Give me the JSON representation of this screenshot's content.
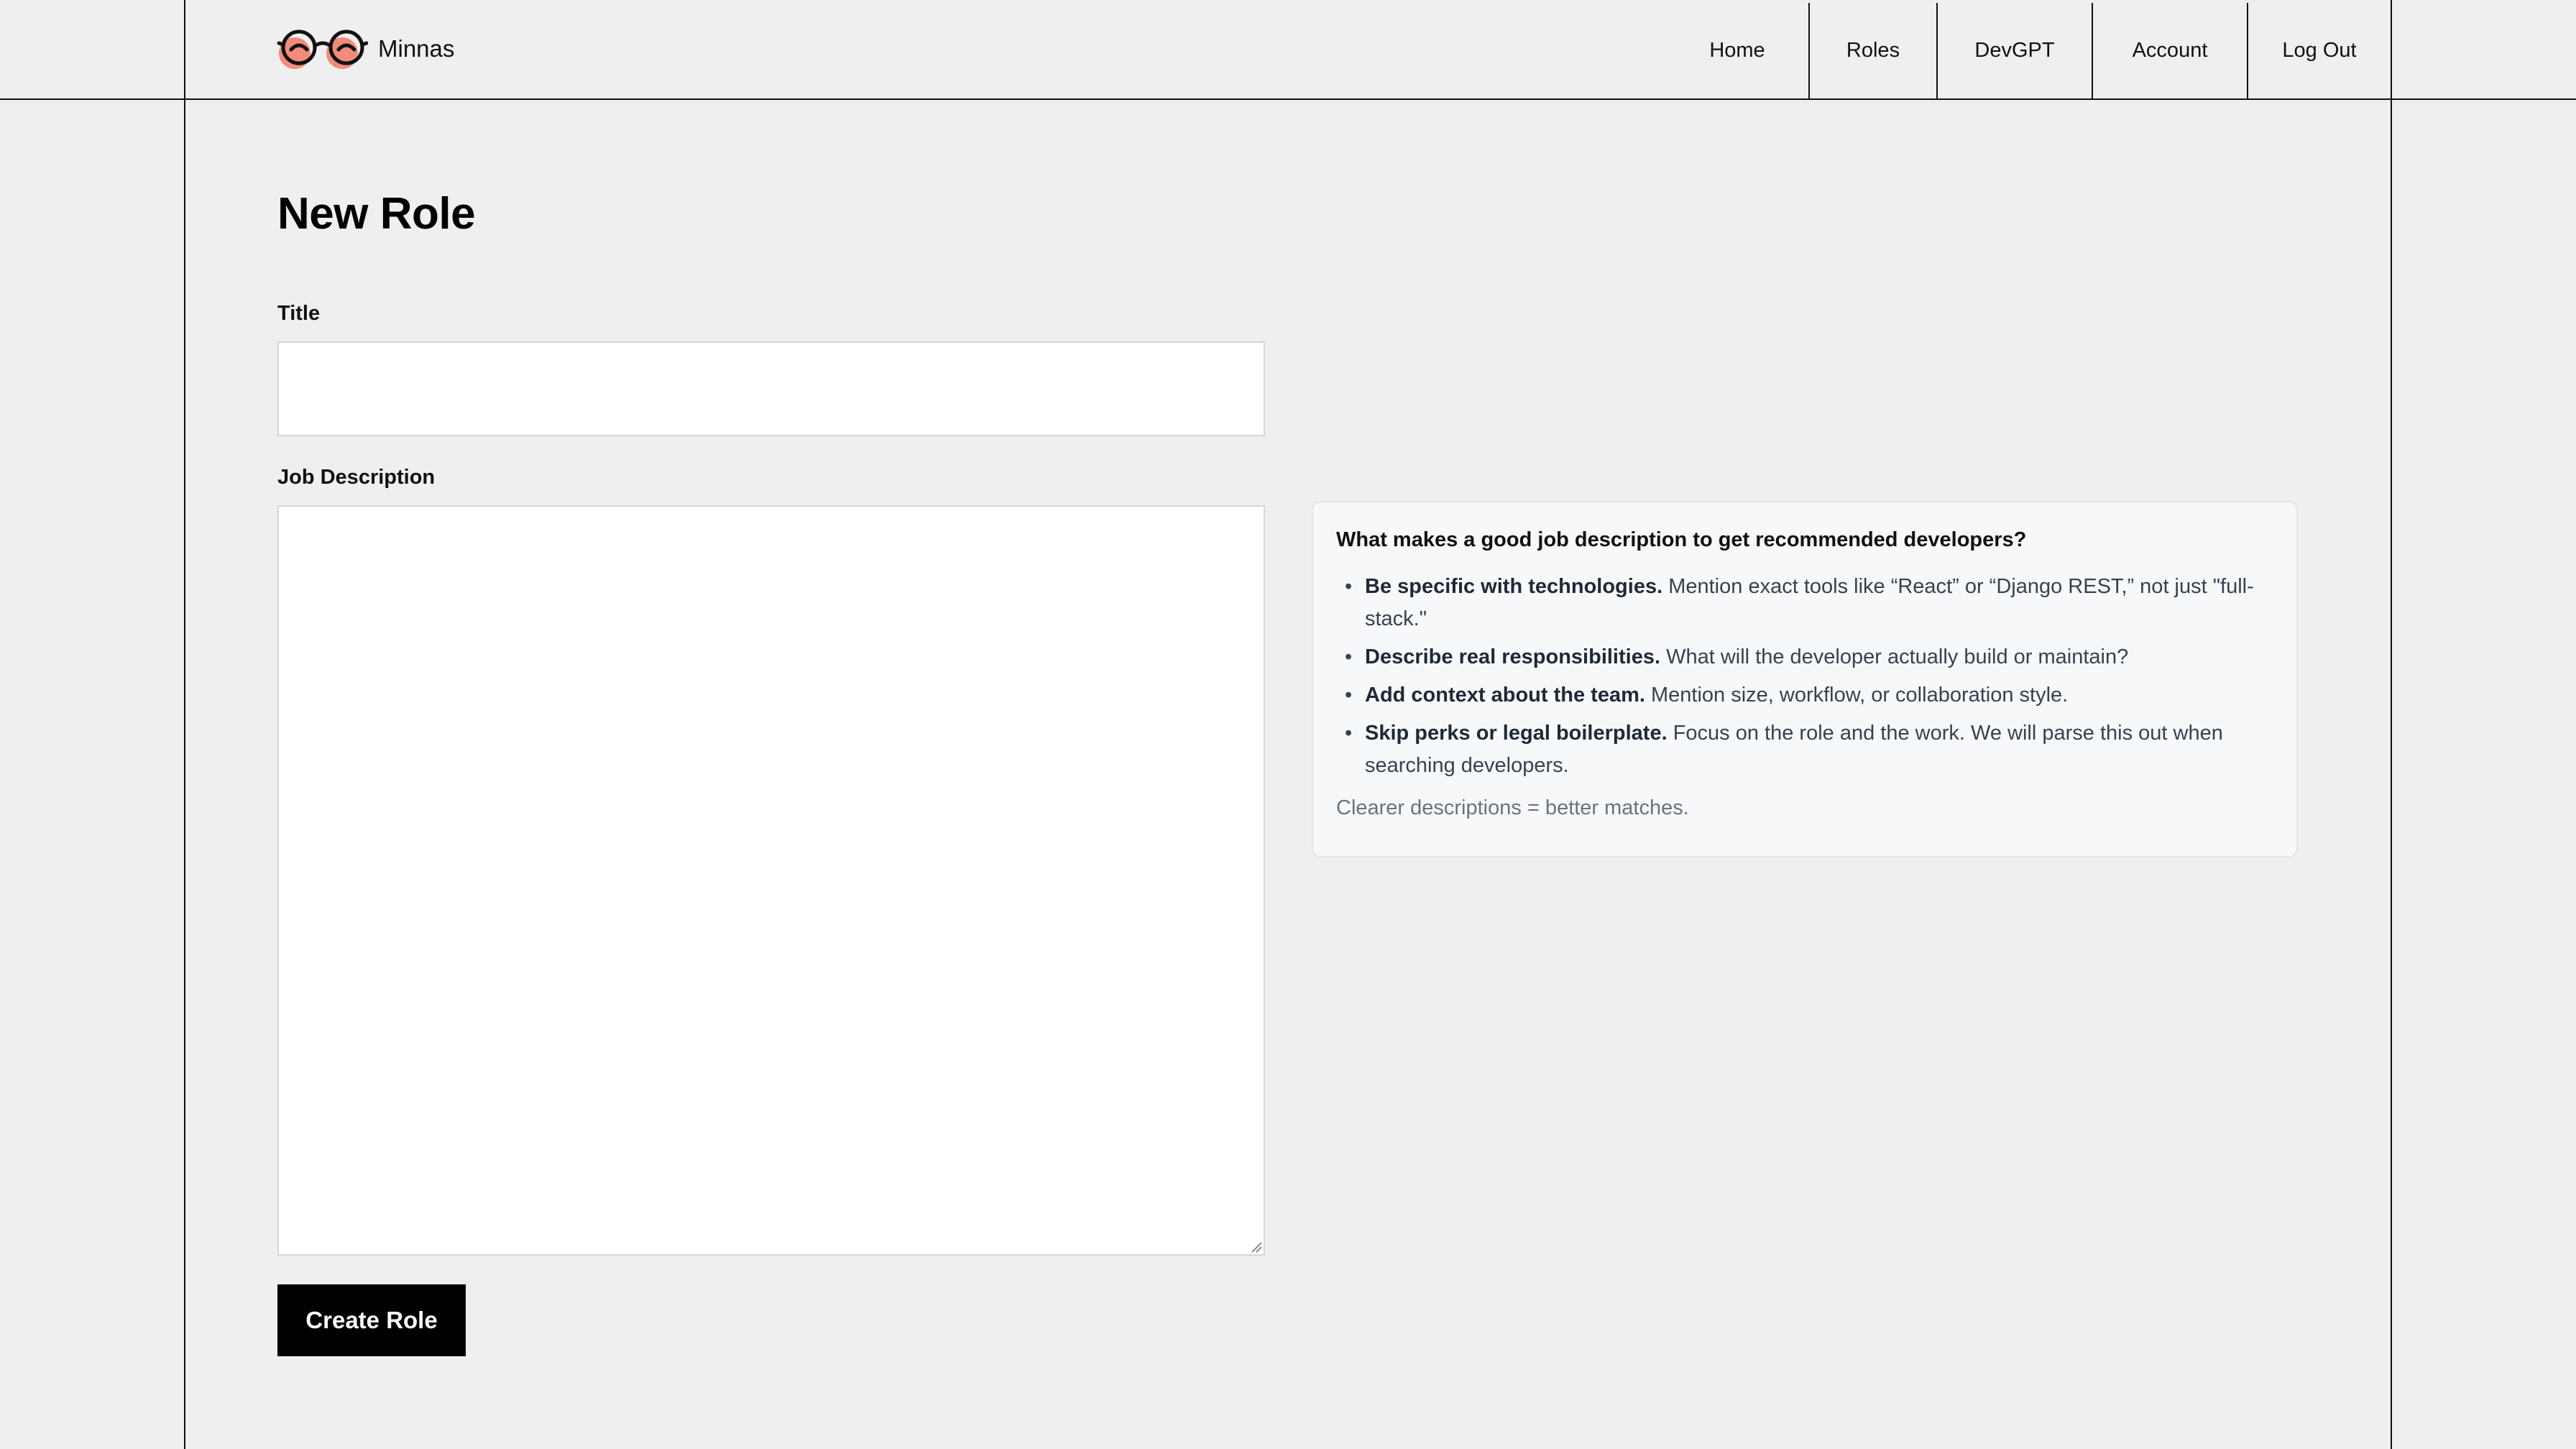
{
  "brand": {
    "name": "Minnas",
    "logo_icon": "glasses-logo-icon",
    "accent_color": "#f28b7b"
  },
  "nav": {
    "items": [
      {
        "label": "Home"
      },
      {
        "label": "Roles"
      },
      {
        "label": "DevGPT"
      },
      {
        "label": "Account"
      },
      {
        "label": "Log Out"
      }
    ]
  },
  "page": {
    "title": "New Role"
  },
  "form": {
    "title_label": "Title",
    "title_value": "",
    "title_placeholder": "",
    "description_label": "Job Description",
    "description_value": "",
    "description_placeholder": "",
    "submit_label": "Create Role"
  },
  "tips": {
    "heading": "What makes a good job description to get recommended developers?",
    "items": [
      {
        "strong": "Be specific with technologies.",
        "text": " Mention exact tools like “React” or “Django REST,” not just \"full-stack.\""
      },
      {
        "strong": "Describe real responsibilities.",
        "text": " What will the developer actually build or maintain?"
      },
      {
        "strong": "Add context about the team.",
        "text": " Mention size, workflow, or collaboration style."
      },
      {
        "strong": "Skip perks or legal boilerplate.",
        "text": " Focus on the role and the work. We will parse this out when searching developers."
      }
    ],
    "footer": "Clearer descriptions = better matches."
  }
}
